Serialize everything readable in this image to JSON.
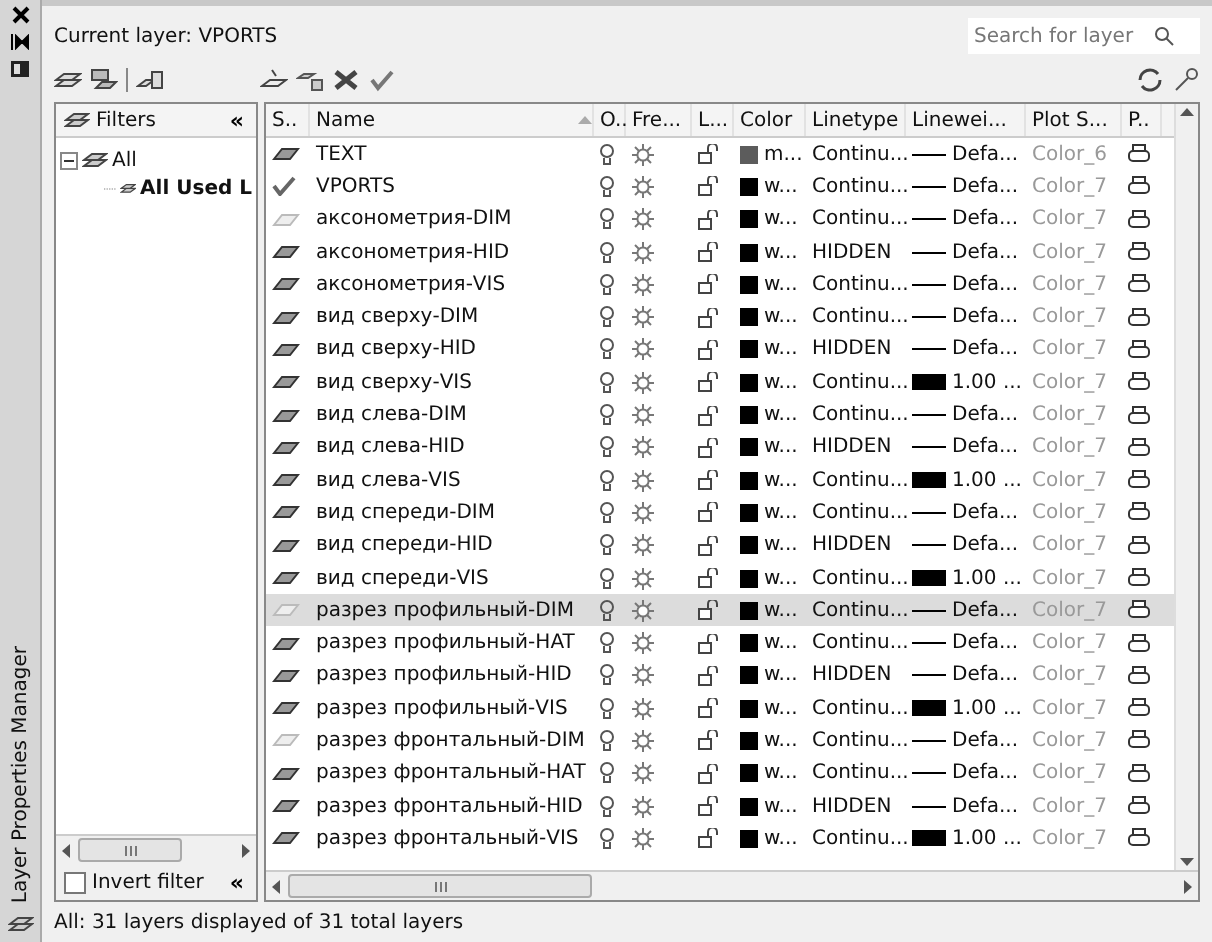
{
  "side_title": "Layer Properties Manager",
  "current_layer": "Current layer: VPORTS",
  "search": {
    "placeholder": "Search for layer"
  },
  "filters": {
    "heading": "Filters",
    "collapse": "«",
    "tree": [
      {
        "label": "All",
        "expanded": true,
        "children": [
          {
            "label": "All Used L"
          }
        ]
      }
    ],
    "invert": {
      "label": "Invert filter",
      "checked": false
    },
    "collapse_bottom": "«"
  },
  "columns": [
    "S..",
    "Name",
    "O..",
    "Fre...",
    "L...",
    "Color",
    "Linetype",
    "Linewei...",
    "Plot S...",
    "P.."
  ],
  "rows": [
    {
      "current": false,
      "in_use": true,
      "name": "TEXT",
      "color_name": "m...",
      "color": "#5c5c5c",
      "linetype": "Continu...",
      "thick_weight": false,
      "lineweight": "Defa...",
      "plot_style": "Color_6",
      "selected": false
    },
    {
      "current": true,
      "in_use": true,
      "name": "VPORTS",
      "color_name": "w...",
      "color": "#000000",
      "linetype": "Continu...",
      "thick_weight": false,
      "lineweight": "Defa...",
      "plot_style": "Color_7",
      "selected": false
    },
    {
      "current": false,
      "in_use": false,
      "name": "аксонометрия-DIM",
      "color_name": "w...",
      "color": "#000000",
      "linetype": "Continu...",
      "thick_weight": false,
      "lineweight": "Defa...",
      "plot_style": "Color_7",
      "selected": false
    },
    {
      "current": false,
      "in_use": true,
      "name": "аксонометрия-HID",
      "color_name": "w...",
      "color": "#000000",
      "linetype": "HIDDEN",
      "thick_weight": false,
      "lineweight": "Defa...",
      "plot_style": "Color_7",
      "selected": false
    },
    {
      "current": false,
      "in_use": true,
      "name": "аксонометрия-VIS",
      "color_name": "w...",
      "color": "#000000",
      "linetype": "Continu...",
      "thick_weight": false,
      "lineweight": "Defa...",
      "plot_style": "Color_7",
      "selected": false
    },
    {
      "current": false,
      "in_use": true,
      "name": "вид сверху-DIM",
      "color_name": "w...",
      "color": "#000000",
      "linetype": "Continu...",
      "thick_weight": false,
      "lineweight": "Defa...",
      "plot_style": "Color_7",
      "selected": false
    },
    {
      "current": false,
      "in_use": true,
      "name": "вид сверху-HID",
      "color_name": "w...",
      "color": "#000000",
      "linetype": "HIDDEN",
      "thick_weight": false,
      "lineweight": "Defa...",
      "plot_style": "Color_7",
      "selected": false
    },
    {
      "current": false,
      "in_use": true,
      "name": "вид сверху-VIS",
      "color_name": "w...",
      "color": "#000000",
      "linetype": "Continu...",
      "thick_weight": true,
      "lineweight": "1.00 ...",
      "plot_style": "Color_7",
      "selected": false
    },
    {
      "current": false,
      "in_use": true,
      "name": "вид слева-DIM",
      "color_name": "w...",
      "color": "#000000",
      "linetype": "Continu...",
      "thick_weight": false,
      "lineweight": "Defa...",
      "plot_style": "Color_7",
      "selected": false
    },
    {
      "current": false,
      "in_use": true,
      "name": "вид слева-HID",
      "color_name": "w...",
      "color": "#000000",
      "linetype": "HIDDEN",
      "thick_weight": false,
      "lineweight": "Defa...",
      "plot_style": "Color_7",
      "selected": false
    },
    {
      "current": false,
      "in_use": true,
      "name": "вид слева-VIS",
      "color_name": "w...",
      "color": "#000000",
      "linetype": "Continu...",
      "thick_weight": true,
      "lineweight": "1.00 ...",
      "plot_style": "Color_7",
      "selected": false
    },
    {
      "current": false,
      "in_use": true,
      "name": "вид спереди-DIM",
      "color_name": "w...",
      "color": "#000000",
      "linetype": "Continu...",
      "thick_weight": false,
      "lineweight": "Defa...",
      "plot_style": "Color_7",
      "selected": false
    },
    {
      "current": false,
      "in_use": true,
      "name": "вид спереди-HID",
      "color_name": "w...",
      "color": "#000000",
      "linetype": "HIDDEN",
      "thick_weight": false,
      "lineweight": "Defa...",
      "plot_style": "Color_7",
      "selected": false
    },
    {
      "current": false,
      "in_use": true,
      "name": "вид спереди-VIS",
      "color_name": "w...",
      "color": "#000000",
      "linetype": "Continu...",
      "thick_weight": true,
      "lineweight": "1.00 ...",
      "plot_style": "Color_7",
      "selected": false
    },
    {
      "current": false,
      "in_use": false,
      "name": "разрез профильный-DIM",
      "color_name": "w...",
      "color": "#000000",
      "linetype": "Continu...",
      "thick_weight": false,
      "lineweight": "Defa...",
      "plot_style": "Color_7",
      "selected": true
    },
    {
      "current": false,
      "in_use": true,
      "name": "разрез профильный-HAT",
      "color_name": "w...",
      "color": "#000000",
      "linetype": "Continu...",
      "thick_weight": false,
      "lineweight": "Defa...",
      "plot_style": "Color_7",
      "selected": false
    },
    {
      "current": false,
      "in_use": true,
      "name": "разрез профильный-HID",
      "color_name": "w...",
      "color": "#000000",
      "linetype": "HIDDEN",
      "thick_weight": false,
      "lineweight": "Defa...",
      "plot_style": "Color_7",
      "selected": false
    },
    {
      "current": false,
      "in_use": true,
      "name": "разрез профильный-VIS",
      "color_name": "w...",
      "color": "#000000",
      "linetype": "Continu...",
      "thick_weight": true,
      "lineweight": "1.00 ...",
      "plot_style": "Color_7",
      "selected": false
    },
    {
      "current": false,
      "in_use": false,
      "name": "разрез фронтальный-DIM",
      "color_name": "w...",
      "color": "#000000",
      "linetype": "Continu...",
      "thick_weight": false,
      "lineweight": "Defa...",
      "plot_style": "Color_7",
      "selected": false
    },
    {
      "current": false,
      "in_use": true,
      "name": "разрез фронтальный-HAT",
      "color_name": "w...",
      "color": "#000000",
      "linetype": "Continu...",
      "thick_weight": false,
      "lineweight": "Defa...",
      "plot_style": "Color_7",
      "selected": false
    },
    {
      "current": false,
      "in_use": true,
      "name": "разрез фронтальный-HID",
      "color_name": "w...",
      "color": "#000000",
      "linetype": "HIDDEN",
      "thick_weight": false,
      "lineweight": "Defa...",
      "plot_style": "Color_7",
      "selected": false
    },
    {
      "current": false,
      "in_use": true,
      "name": "разрез фронтальный-VIS",
      "color_name": "w...",
      "color": "#000000",
      "linetype": "Continu...",
      "thick_weight": true,
      "lineweight": "1.00 ...",
      "plot_style": "Color_7",
      "selected": false
    }
  ],
  "status_bar": "All: 31 layers displayed of 31 total layers"
}
